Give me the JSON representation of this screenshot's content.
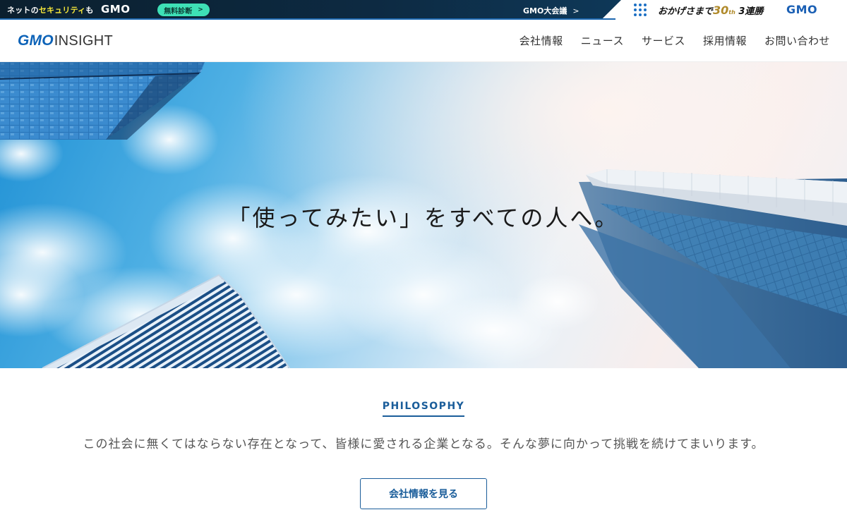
{
  "promo_bar": {
    "lead_prefix": "ネットの",
    "lead_highlight": "セキュリティ",
    "lead_suffix": "も",
    "brand": "GMO",
    "pill_label": "無料診断",
    "pill_chevron": ">",
    "conference_label": "GMO大会議",
    "conference_chevron": ">",
    "slogan_prefix": "おかげさまで",
    "slogan_number": "30",
    "slogan_suffix_small": "th",
    "slogan_suffix": "3連勝",
    "brand_right": "GMO",
    "dark_color": "#0d2a42",
    "pill_color": "#3ee0b6",
    "highlight_color": "#f5e63a"
  },
  "header": {
    "logo_gmo": "GMO",
    "logo_insight": "INSIGHT",
    "nav": [
      "会社情報",
      "ニュース",
      "サービス",
      "採用情報",
      "お問い合わせ"
    ],
    "brand_color": "#0d63b8"
  },
  "hero": {
    "tagline": "「使ってみたい」をすべての人へ。"
  },
  "philosophy": {
    "heading": "PHILOSOPHY",
    "text": "この社会に無くてはならない存在となって、皆様に愛される企業となる。そんな夢に向かって挑戦を続けてまいります。",
    "cta_label": "会社情報を見る",
    "accent_color": "#1a5d9a"
  }
}
